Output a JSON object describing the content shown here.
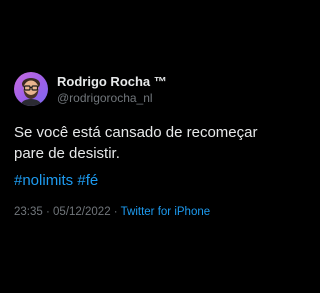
{
  "author": {
    "name": "Rodrigo Rocha ™",
    "handle": "@rodrigorocha_nl"
  },
  "tweet": {
    "text_line_1": "Se você está cansado de recomeçar",
    "text_line_2": "pare de desistir.",
    "hashtags": [
      "#nolimits",
      "#fé"
    ]
  },
  "meta": {
    "time": "23:35",
    "separator_1": "·",
    "date": "05/12/2022",
    "separator_2": "·",
    "source": "Twitter for iPhone"
  },
  "colors": {
    "background": "#000000",
    "text": "#e7e9ea",
    "secondary": "#71767b",
    "accent": "#1d9bf0"
  }
}
